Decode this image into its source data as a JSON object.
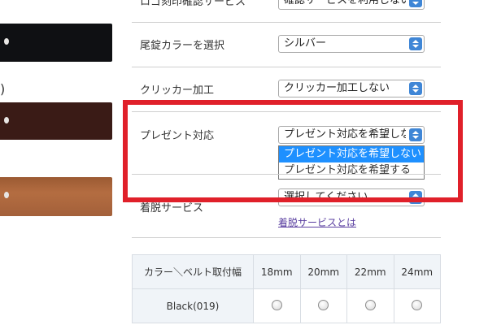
{
  "left_panel": {
    "paren": ")"
  },
  "form": {
    "row0": {
      "label": "ロゴ刻印確認サービス",
      "select_value": "確認サービスを利用しない"
    },
    "tail_color": {
      "label": "尾錠カラーを選択",
      "select_value": "シルバー"
    },
    "clicker": {
      "label": "クリッカー加工",
      "select_value": "クリッカー加工しない"
    },
    "gift": {
      "label": "プレゼント対応",
      "select_value": "プレゼント対応を希望しない",
      "options": [
        "プレゼント対応を希望しない",
        "プレゼント対応を希望する"
      ],
      "selected_index": 0
    },
    "removal": {
      "label": "着脱サービス",
      "select_value": "選択してください",
      "link": "着脱サービスとは"
    }
  },
  "size_table": {
    "header": [
      "カラー＼ベルト取付幅",
      "18mm",
      "20mm",
      "22mm",
      "24mm"
    ],
    "rows": [
      {
        "name": "Black(019)"
      }
    ]
  },
  "colors": {
    "highlight": "#e0202a",
    "accent": "#3f86d6",
    "option_selected": "#1e90ff"
  }
}
